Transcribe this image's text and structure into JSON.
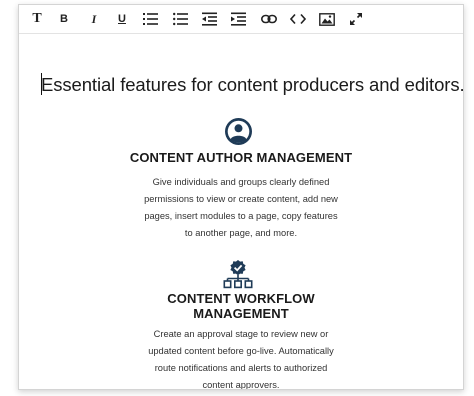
{
  "toolbar": {
    "buttons": [
      {
        "name": "text-style-button",
        "label": "T"
      },
      {
        "name": "bold-button",
        "label": "B"
      },
      {
        "name": "italic-button",
        "label": "I"
      },
      {
        "name": "underline-button",
        "label": "U"
      },
      {
        "name": "ordered-list-button",
        "icon": "ordered-list-icon"
      },
      {
        "name": "bullet-list-button",
        "icon": "bullet-list-icon"
      },
      {
        "name": "outdent-button",
        "icon": "outdent-icon"
      },
      {
        "name": "indent-button",
        "icon": "indent-icon"
      },
      {
        "name": "link-button",
        "icon": "link-icon"
      },
      {
        "name": "code-button",
        "icon": "code-icon"
      },
      {
        "name": "image-button",
        "icon": "image-icon"
      },
      {
        "name": "expand-button",
        "icon": "expand-icon"
      }
    ]
  },
  "document": {
    "headline": "Essential features for content producers and editors.",
    "features": [
      {
        "icon": "user-circle-icon",
        "title": "CONTENT AUTHOR MANAGEMENT",
        "desc_lines": [
          "Give individuals and groups clearly defined",
          "permissions to view or create content, add new",
          "pages, insert modules to a page, copy features",
          "to another page, and more."
        ]
      },
      {
        "icon": "workflow-hierarchy-icon",
        "title_lines": [
          "CONTENT WORKFLOW",
          "MANAGEMENT"
        ],
        "desc_lines": [
          "Create an approval stage to review new or",
          "updated content before go-live. Automatically",
          "route notifications and alerts to authorized"
        ],
        "desc_last_prefix": "content ",
        "desc_last_flagged": "approvers",
        "desc_last_suffix": "."
      }
    ]
  },
  "colors": {
    "icon_navy": "#1f3b57",
    "spellcheck_red": "#e04848"
  }
}
